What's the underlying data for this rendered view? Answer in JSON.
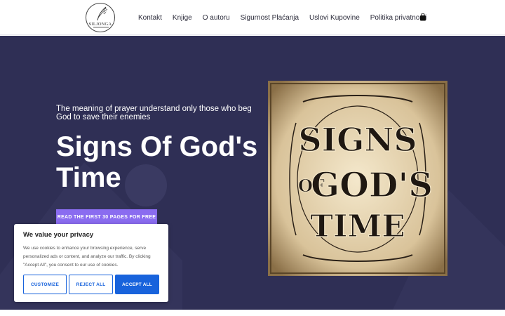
{
  "header": {
    "logo_text": "SILJONGA",
    "nav": [
      "Kontakt",
      "Knjige",
      "O autoru",
      "Sigurnost Plaćanja",
      "Uslovi Kupovine",
      "Politika privatnosti"
    ],
    "cart_icon": "shopping-bag-icon"
  },
  "hero": {
    "tagline": "The meaning of prayer understand only those who beg God to save their enemies",
    "title": "Signs Of God's Time",
    "cta_label": "READ THE FIRST 30 PAGES FOR FREE",
    "cover_text": {
      "line1": "SIGNS",
      "line2_left": "OF",
      "line2_right": "GOD'S",
      "line3": "TIME"
    }
  },
  "cookie": {
    "title": "We value your privacy",
    "text": "We use cookies to enhance your browsing experience, serve personalized ads or content, and analyze our traffic. By clicking \"Accept All\", you consent to our use of cookies.",
    "customize": "CUSTOMIZE",
    "reject": "REJECT ALL",
    "accept": "ACCEPT ALL"
  },
  "colors": {
    "hero_bg": "#2f2f55",
    "cta": "#8a6cf0",
    "cookie_accent": "#1863dc"
  }
}
